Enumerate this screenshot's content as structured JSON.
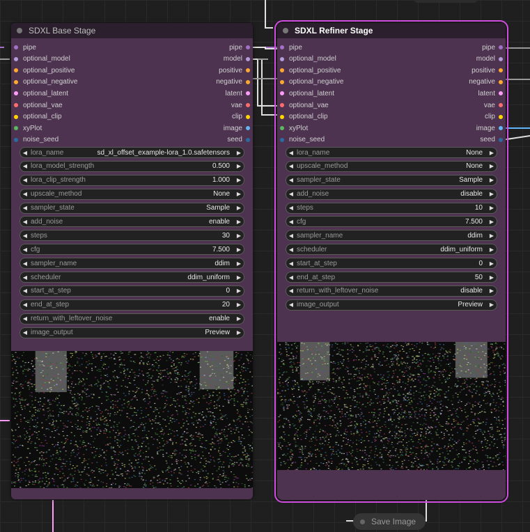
{
  "colors": {
    "pipe": "#a371c7",
    "model": "#b39ddb",
    "positive": "#ffa931",
    "negative": "#ffa931",
    "latent": "#ff9cf9",
    "vae": "#ff6e6e",
    "clip": "#ffd500",
    "xyPlot": "#5cb85c",
    "image": "#64b5f6",
    "seed": "#2c6aa3",
    "node_body": "#4e3351",
    "selected_outline": "#d04be0"
  },
  "base_node": {
    "title": "SDXL Base Stage",
    "inputs": [
      {
        "label": "pipe",
        "type": "pipe"
      },
      {
        "label": "optional_model",
        "type": "model"
      },
      {
        "label": "optional_positive",
        "type": "positive"
      },
      {
        "label": "optional_negative",
        "type": "negative"
      },
      {
        "label": "optional_latent",
        "type": "latent"
      },
      {
        "label": "optional_vae",
        "type": "vae"
      },
      {
        "label": "optional_clip",
        "type": "clip"
      },
      {
        "label": "xyPlot",
        "type": "xyPlot"
      },
      {
        "label": "noise_seed",
        "type": "seed"
      }
    ],
    "outputs": [
      {
        "label": "pipe",
        "type": "pipe"
      },
      {
        "label": "model",
        "type": "model"
      },
      {
        "label": "positive",
        "type": "positive"
      },
      {
        "label": "negative",
        "type": "negative"
      },
      {
        "label": "latent",
        "type": "latent"
      },
      {
        "label": "vae",
        "type": "vae"
      },
      {
        "label": "clip",
        "type": "clip"
      },
      {
        "label": "image",
        "type": "image"
      },
      {
        "label": "seed",
        "type": "seed"
      }
    ],
    "widgets": [
      {
        "label": "lora_name",
        "value": "sd_xl_offset_example-lora_1.0.safetensors"
      },
      {
        "label": "lora_model_strength",
        "value": "0.500"
      },
      {
        "label": "lora_clip_strength",
        "value": "1.000"
      },
      {
        "label": "upscale_method",
        "value": "None"
      },
      {
        "label": "sampler_state",
        "value": "Sample"
      },
      {
        "label": "add_noise",
        "value": "enable"
      },
      {
        "label": "steps",
        "value": "30"
      },
      {
        "label": "cfg",
        "value": "7.500"
      },
      {
        "label": "sampler_name",
        "value": "ddim"
      },
      {
        "label": "scheduler",
        "value": "ddim_uniform"
      },
      {
        "label": "start_at_step",
        "value": "0"
      },
      {
        "label": "end_at_step",
        "value": "20"
      },
      {
        "label": "return_with_leftover_noise",
        "value": "enable"
      },
      {
        "label": "image_output",
        "value": "Preview"
      }
    ]
  },
  "refiner_node": {
    "title": "SDXL Refiner Stage",
    "inputs": [
      {
        "label": "pipe",
        "type": "pipe"
      },
      {
        "label": "optional_model",
        "type": "model"
      },
      {
        "label": "optional_positive",
        "type": "positive"
      },
      {
        "label": "optional_negative",
        "type": "negative"
      },
      {
        "label": "optional_latent",
        "type": "latent"
      },
      {
        "label": "optional_vae",
        "type": "vae"
      },
      {
        "label": "optional_clip",
        "type": "clip"
      },
      {
        "label": "xyPlot",
        "type": "xyPlot"
      },
      {
        "label": "noise_seed",
        "type": "seed"
      }
    ],
    "outputs": [
      {
        "label": "pipe",
        "type": "pipe"
      },
      {
        "label": "model",
        "type": "model"
      },
      {
        "label": "positive",
        "type": "positive"
      },
      {
        "label": "negative",
        "type": "negative"
      },
      {
        "label": "latent",
        "type": "latent"
      },
      {
        "label": "vae",
        "type": "vae"
      },
      {
        "label": "clip",
        "type": "clip"
      },
      {
        "label": "image",
        "type": "image"
      },
      {
        "label": "seed",
        "type": "seed"
      }
    ],
    "widgets": [
      {
        "label": "lora_name",
        "value": "None"
      },
      {
        "label": "upscale_method",
        "value": "None"
      },
      {
        "label": "sampler_state",
        "value": "Sample"
      },
      {
        "label": "add_noise",
        "value": "disable"
      },
      {
        "label": "steps",
        "value": "10"
      },
      {
        "label": "cfg",
        "value": "7.500"
      },
      {
        "label": "sampler_name",
        "value": "ddim"
      },
      {
        "label": "scheduler",
        "value": "ddim_uniform"
      },
      {
        "label": "start_at_step",
        "value": "0"
      },
      {
        "label": "end_at_step",
        "value": "50"
      },
      {
        "label": "return_with_leftover_noise",
        "value": "disable"
      },
      {
        "label": "image_output",
        "value": "Preview"
      }
    ]
  },
  "save_node": {
    "title": "Save Image"
  },
  "icons": {
    "left_arrow": "triangle-left-icon",
    "right_arrow": "triangle-right-icon",
    "node_collapse": "dot-icon"
  }
}
